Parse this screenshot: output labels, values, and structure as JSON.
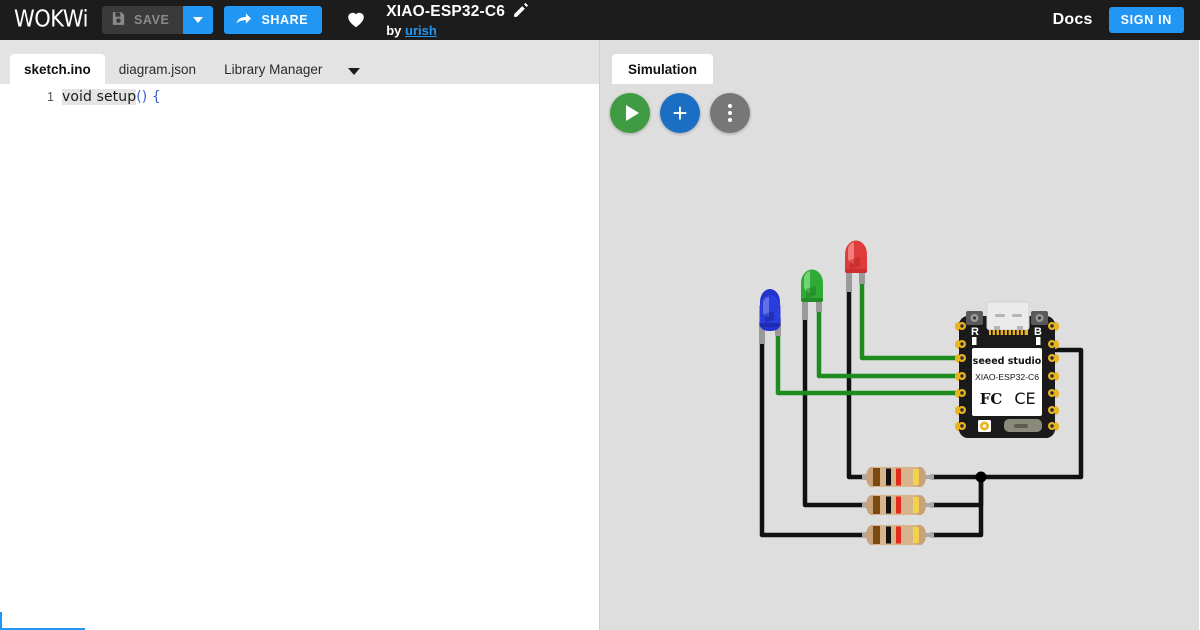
{
  "topbar": {
    "logo_text": "WOKWi",
    "save_label": "SAVE",
    "save_icon": "floppy-disk-icon",
    "save_dropdown_icon": "chevron-down-icon",
    "share_label": "SHARE",
    "share_icon": "share-arrow-icon",
    "favorite_icon": "heart-icon",
    "project_title": "XIAO-ESP32-C6",
    "edit_icon": "pencil-icon",
    "by_label": "by",
    "author": "urish",
    "docs_label": "Docs",
    "signin_label": "SIGN IN",
    "accent_color": "#2196f3",
    "bar_background": "#1c1c1c"
  },
  "editor": {
    "tabs": [
      {
        "label": "sketch.ino",
        "active": true
      },
      {
        "label": "diagram.json",
        "active": false
      },
      {
        "label": "Library Manager",
        "active": false
      }
    ],
    "tabs_overflow_icon": "chevron-down-icon",
    "lines": [
      {
        "number": "1",
        "selected_text": "void setup",
        "punct_text": "() {"
      }
    ],
    "status_accent": "#2196f3"
  },
  "simulation": {
    "tab_label": "Simulation",
    "buttons": [
      {
        "name": "play",
        "label": "",
        "icon": "play-icon",
        "color": "#3f9c42"
      },
      {
        "name": "add-part",
        "label": "",
        "icon": "plus-icon",
        "color": "#1a6fc4"
      },
      {
        "name": "more-menu",
        "label": "",
        "icon": "kebab-menu-icon",
        "color": "#777777"
      }
    ],
    "canvas_background": "#dedede"
  },
  "circuit": {
    "board": {
      "name": "XIAO-ESP32-C6",
      "vendor_text": "seeed studio",
      "model_text": "XIAO-ESP32-C6",
      "cert_marks": [
        "FCC",
        "CE"
      ],
      "button_labels": [
        "R",
        "B"
      ],
      "body_color": "#1a1a1a",
      "pad_color": "#e8b421",
      "label_color": "#ffffff",
      "pins_per_side": 7
    },
    "leds": [
      {
        "name": "led-blue",
        "color": "#2233cc",
        "highlight": "#6a7ae8"
      },
      {
        "name": "led-green",
        "color": "#2faa34",
        "highlight": "#7ddc7f"
      },
      {
        "name": "led-red",
        "color": "#e03b3b",
        "highlight": "#f58a8a"
      }
    ],
    "resistors": [
      {
        "name": "resistor-1",
        "bands": [
          "brown",
          "black",
          "red",
          "gold"
        ],
        "body_color": "#d8b48c"
      },
      {
        "name": "resistor-2",
        "bands": [
          "brown",
          "black",
          "red",
          "gold"
        ],
        "body_color": "#d8b48c"
      },
      {
        "name": "resistor-3",
        "bands": [
          "brown",
          "black",
          "red",
          "gold"
        ],
        "body_color": "#d8b48c"
      }
    ],
    "wires": {
      "signal_color": "#1f8b1f",
      "ground_color": "#111111",
      "junction_color": "#000000"
    }
  }
}
